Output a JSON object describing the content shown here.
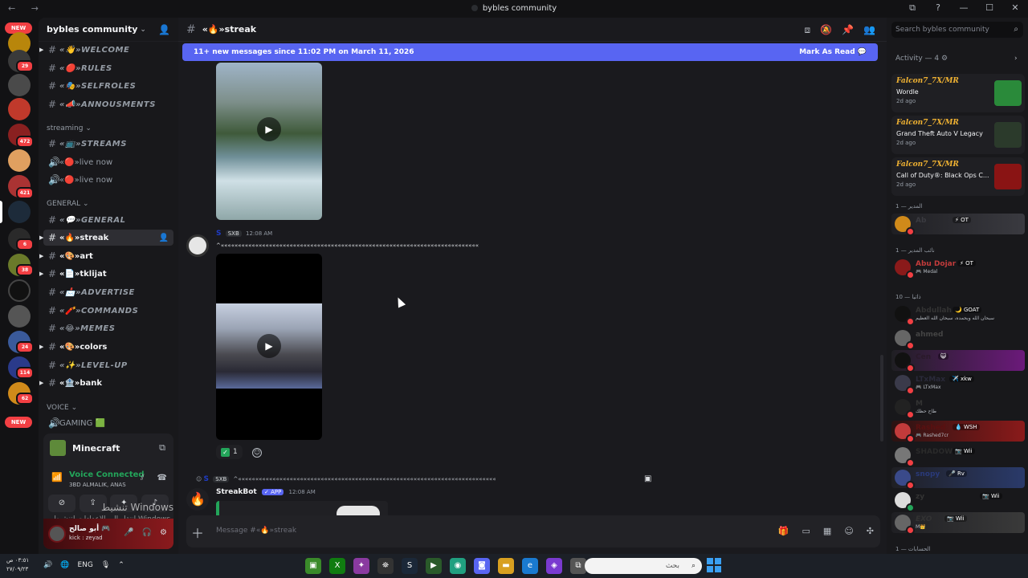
{
  "window": {
    "title": "bybles community",
    "nav_arrows": "← →",
    "controls": [
      "⧉",
      "?",
      "—",
      "☐",
      "✕"
    ]
  },
  "rail": {
    "new_label": "NEW",
    "badges": [
      "29",
      "472",
      "421",
      "6",
      "38",
      "24",
      "114",
      "62"
    ]
  },
  "sidebar": {
    "guild_name": "bybles community",
    "channels": [
      {
        "label": "«👋»WELCOME",
        "style": "italic"
      },
      {
        "label": "«🔴»RULES",
        "style": "italic"
      },
      {
        "label": "«🎭»SELFROLES",
        "style": "italic"
      },
      {
        "label": "«📣»ANNOUSMENTS",
        "style": "italic"
      },
      {
        "label": "«📺»STREAMS",
        "style": "italic"
      },
      {
        "label": "«🔴»live now",
        "style": "voice"
      },
      {
        "label": "«🔴»live now",
        "style": "voice"
      },
      {
        "label": "«💬»GENERAL",
        "style": "italic"
      },
      {
        "label": "«🔥»streak",
        "style": "active"
      },
      {
        "label": "«🎨»art",
        "style": "bold"
      },
      {
        "label": "«📄»tklijat",
        "style": "bold"
      },
      {
        "label": "«📩»ADVERTISE",
        "style": "italic"
      },
      {
        "label": "«🧨»COMMANDS",
        "style": "italic"
      },
      {
        "label": "«😂»MEMES",
        "style": "italic"
      },
      {
        "label": "«🎨»colors",
        "style": "bold"
      },
      {
        "label": "«✨»LEVEL-UP",
        "style": "italic"
      },
      {
        "label": "«🏦»bank",
        "style": "bold"
      },
      {
        "label": "GAMING 🟩",
        "style": "voice"
      }
    ],
    "categories": [
      "streaming",
      "GENERAL",
      "VOICE"
    ]
  },
  "voice": {
    "game": "Minecraft",
    "status": "Voice Connected",
    "channel": "3BD ALMALIK, ANAS"
  },
  "user": {
    "name": "أبو صالح 🎮",
    "status": "kick : zeyad"
  },
  "watermark": {
    "line1": "تنشيط Windows",
    "line2": "انتقل إلى الإعدادات لتنشيط Windows."
  },
  "chat": {
    "channel_name": "«🔥»streak",
    "new_messages": "11+ new messages since 11:02 PM on March 11, 2026",
    "mark_read": "Mark As Read",
    "msg1": {
      "tag": "SXB",
      "time": "12:08 AM",
      "text": "^«««««««««««««««««««««««««««««««««««««««««««««««««««««««««««««««««««««««««««"
    },
    "reaction_count": "1",
    "reply": {
      "tag": "SXB",
      "text": "^«««««««««««««««««««««««««««««««««««««««««««««««««««««««««««««««««««««««««««"
    },
    "bot": {
      "name": "StreakBot",
      "app": "APP",
      "time": "12:08 AM"
    },
    "composer_placeholder": "Message #«🔥»streak"
  },
  "members": {
    "search_placeholder": "Search bybles community",
    "activity_header": "Activity — 4",
    "activities": [
      {
        "who": "Falcon7_7X/MR",
        "game": "Wordle",
        "ago": "2d ago",
        "color": "#3a8a3a"
      },
      {
        "who": "Falcon7_7X/MR",
        "game": "Grand Theft Auto V Legacy",
        "ago": "2d ago",
        "color": "#2b3a2b"
      },
      {
        "who": "Falcon7_7X/MR",
        "game": "Call of Duty®: Black Ops C...",
        "ago": "2d ago",
        "color": "#8a1414"
      }
    ],
    "cat_admin": "المدير — 1",
    "cat_deputy": "نائب المدير — 1",
    "cat_third": "ذاتيا — 10",
    "cat_fourth": "الحسابات — 1",
    "rows": [
      {
        "name": "Ab",
        "tag": "⚡ OT",
        "sub": "",
        "color": "#3a2a2a",
        "bg": "linear-gradient(90deg,#1f1f23,#3a3a40)"
      },
      {
        "name": "Abu Dojar",
        "tag": "⚡ OT",
        "sub": "🎮 Medal",
        "color": "#c23b3b",
        "bg": "#1f1f23"
      },
      {
        "name": "Abdullah",
        "tag": "🌙 GOAT",
        "sub": "سبحان الله وبحمده، سبحان الله العظيم",
        "color": "#333",
        "bg": "#18181b"
      },
      {
        "name": "ahmed",
        "tag": "",
        "sub": "",
        "color": "#555",
        "bg": "#18181b"
      },
      {
        "name": "Cen",
        "tag": "😺",
        "sub": "",
        "color": "#222",
        "bg": "linear-gradient(90deg,#1f1f23,#6b1a7a)"
      },
      {
        "name": "LTxMax",
        "tag": "✈️ xkw",
        "sub": "🎮 LTxMax",
        "color": "#2a2a3a",
        "bg": "#18181b"
      },
      {
        "name": "M",
        "tag": "",
        "sub": "طاح حظك",
        "color": "#222",
        "bg": "#18181b"
      },
      {
        "name": "Rashed",
        "tag": "💧 WSH",
        "sub": "🎮 Rashed7cr",
        "color": "#8a1a1a",
        "bg": "linear-gradient(90deg,#2a1212,#8a1a1a)"
      },
      {
        "name": "SHADOW",
        "tag": "📷 Wii",
        "sub": "",
        "color": "#555",
        "bg": "#18181b"
      },
      {
        "name": "snopy",
        "tag": "🎤 Rv",
        "sub": "",
        "color": "#3a4a8a",
        "bg": "linear-gradient(90deg,#1f1f23,#2a3a6a)"
      },
      {
        "name": "zy",
        "tag": "📷 Wii",
        "sub": "",
        "color": "#ddd",
        "bg": "#18181b"
      },
      {
        "name": "EXO",
        "tag": "📷 Wii",
        "sub": "M👑",
        "color": "#555",
        "bg": "linear-gradient(90deg,#1f1f23,#3a3a3a)"
      }
    ]
  },
  "taskbar": {
    "time": "٠٣:٥١ ص",
    "date": "٢٧/٠٩/٢٣",
    "lang": "ENG",
    "search_text": "بحث"
  },
  "colors": {
    "accent": "#5865f2",
    "online": "#23a55a",
    "danger": "#f23f43"
  }
}
